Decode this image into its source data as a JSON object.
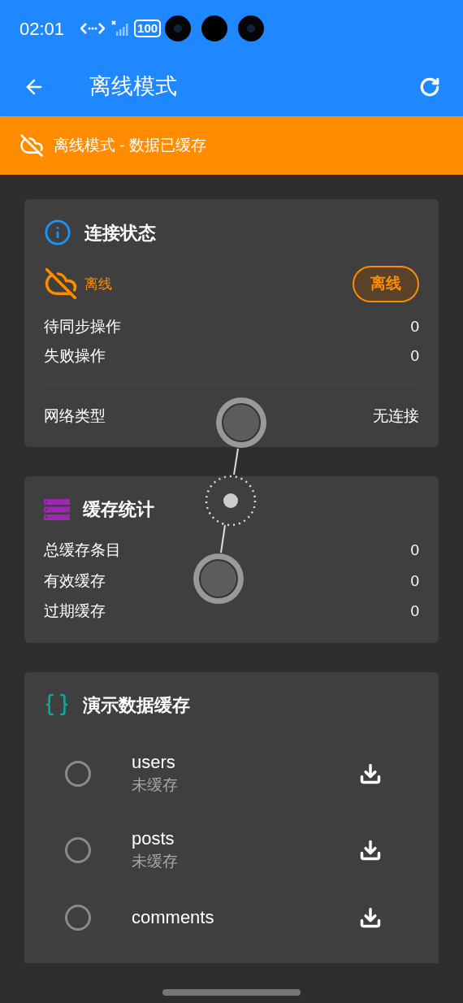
{
  "status_bar": {
    "time": "02:01",
    "battery": "100"
  },
  "app_bar": {
    "title": "离线模式"
  },
  "banner": {
    "text": "离线模式 - 数据已缓存"
  },
  "connection_card": {
    "title": "连接状态",
    "status": "离线",
    "badge": "离线",
    "online": false,
    "rows": [
      {
        "label": "待同步操作",
        "value": "0"
      },
      {
        "label": "失败操作",
        "value": "0"
      }
    ],
    "network": {
      "label": "网络类型",
      "value": "无连接"
    }
  },
  "cache_card": {
    "title": "缓存统计",
    "rows": [
      {
        "label": "总缓存条目",
        "value": "0"
      },
      {
        "label": "有效缓存",
        "value": "0"
      },
      {
        "label": "过期缓存",
        "value": "0"
      }
    ]
  },
  "demo_card": {
    "title": "演示数据缓存",
    "items": [
      {
        "name": "users",
        "status": "未缓存",
        "checked": false
      },
      {
        "name": "posts",
        "status": "未缓存",
        "checked": false
      },
      {
        "name": "comments",
        "checked": false
      }
    ]
  }
}
